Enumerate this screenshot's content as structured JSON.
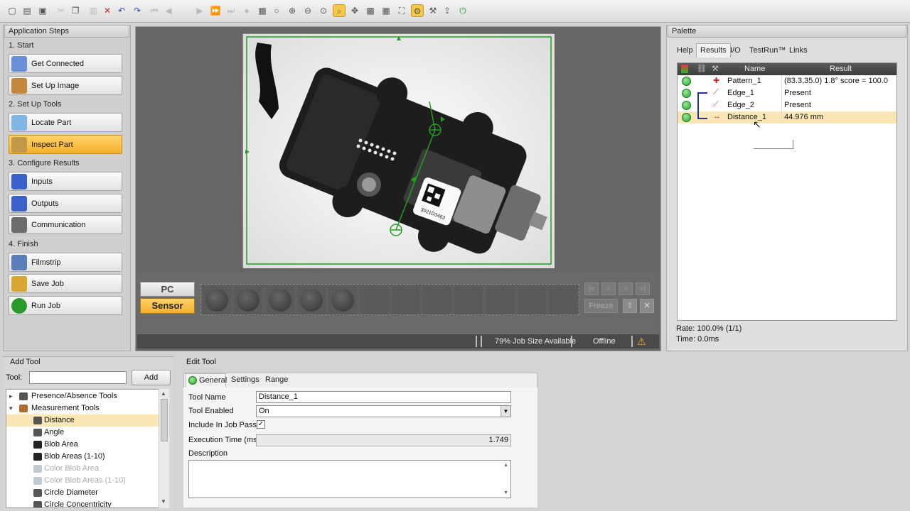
{
  "toolbar": {
    "icons": [
      "new-icon",
      "open-icon",
      "save-icon",
      "cut-icon",
      "copy-icon",
      "paste-icon",
      "delete-icon",
      "undo-icon",
      "redo-icon",
      "first-icon",
      "prev-icon",
      "play-icon",
      "next-icon",
      "last-icon",
      "record-icon",
      "folder-icon",
      "circle-icon",
      "zoom-in-icon",
      "zoom-out-icon",
      "zoom-fit-icon",
      "zoom-actual-icon",
      "pan-icon",
      "image-icon",
      "grid-icon",
      "fullscreen-icon",
      "settings-icon",
      "tools-icon",
      "export-icon",
      "power-icon"
    ]
  },
  "steps": {
    "title": "Application Steps",
    "sections": [
      {
        "label": "1. Start",
        "buttons": [
          {
            "label": "Get Connected",
            "icon": "connect-icon"
          },
          {
            "label": "Set Up Image",
            "icon": "image-setup-icon"
          }
        ]
      },
      {
        "label": "2. Set Up Tools",
        "buttons": [
          {
            "label": "Locate Part",
            "icon": "magnifier-icon"
          },
          {
            "label": "Inspect Part",
            "icon": "tools-icon",
            "active": true
          }
        ]
      },
      {
        "label": "3. Configure Results",
        "buttons": [
          {
            "label": "Inputs",
            "icon": "inputs-icon"
          },
          {
            "label": "Outputs",
            "icon": "outputs-icon"
          },
          {
            "label": "Communication",
            "icon": "communication-icon"
          }
        ]
      },
      {
        "label": "4. Finish",
        "buttons": [
          {
            "label": "Filmstrip",
            "icon": "filmstrip-icon"
          },
          {
            "label": "Save Job",
            "icon": "save-job-icon"
          },
          {
            "label": "Run Job",
            "icon": "run-icon"
          }
        ]
      }
    ]
  },
  "image": {
    "mode_pc": "PC",
    "mode_sensor": "Sensor",
    "freeze_label": "Freeze",
    "status_job_size": "79% Job Size Available",
    "status_online": "Offline",
    "barcode_text": "3021D3463"
  },
  "palette": {
    "title": "Palette",
    "tabs": [
      "Help",
      "Results",
      "I/O",
      "TestRun™",
      "Links"
    ],
    "active_tab": "Results",
    "columns": {
      "name": "Name",
      "result": "Result"
    },
    "rows": [
      {
        "name": "Pattern_1",
        "result": "(83.3,35.0) 1.8° score = 100.0",
        "icon": "pattern-icon"
      },
      {
        "name": "Edge_1",
        "result": "Present",
        "icon": "edge-icon"
      },
      {
        "name": "Edge_2",
        "result": "Present",
        "icon": "edge-icon"
      },
      {
        "name": "Distance_1",
        "result": "44.976 mm",
        "icon": "distance-icon",
        "selected": true
      }
    ],
    "rate": "Rate: 100.0% (1/1)",
    "time": "Time: 0.0ms"
  },
  "add_tool": {
    "title": "Add Tool",
    "tool_label": "Tool:",
    "tool_value": "",
    "add_button": "Add",
    "tree": [
      {
        "label": "Presence/Absence Tools",
        "level": 0,
        "expander": "▸"
      },
      {
        "label": "Measurement Tools",
        "level": 0,
        "expander": "▾"
      },
      {
        "label": "Distance",
        "level": 1,
        "selected": true
      },
      {
        "label": "Angle",
        "level": 1
      },
      {
        "label": "Blob Area",
        "level": 1
      },
      {
        "label": "Blob Areas (1-10)",
        "level": 1
      },
      {
        "label": "Color Blob Area",
        "level": 1,
        "disabled": true
      },
      {
        "label": "Color Blob Areas (1-10)",
        "level": 1,
        "disabled": true
      },
      {
        "label": "Circle Diameter",
        "level": 1
      },
      {
        "label": "Circle Concentricity",
        "level": 1
      }
    ]
  },
  "edit_tool": {
    "title": "Edit Tool",
    "tabs": [
      "General",
      "Settings",
      "Range Limits"
    ],
    "tool_name_label": "Tool Name",
    "tool_name_value": "Distance_1",
    "tool_enabled_label": "Tool Enabled",
    "tool_enabled_value": "On",
    "include_label": "Include In Job Pass",
    "include_checked": true,
    "exec_label": "Execution Time (ms)",
    "exec_value": "1.749",
    "description_label": "Description",
    "description_value": ""
  },
  "colors": {
    "accent": "#f4b02c",
    "overlay_green": "#1fa01f",
    "status_ok": "#27a527"
  }
}
